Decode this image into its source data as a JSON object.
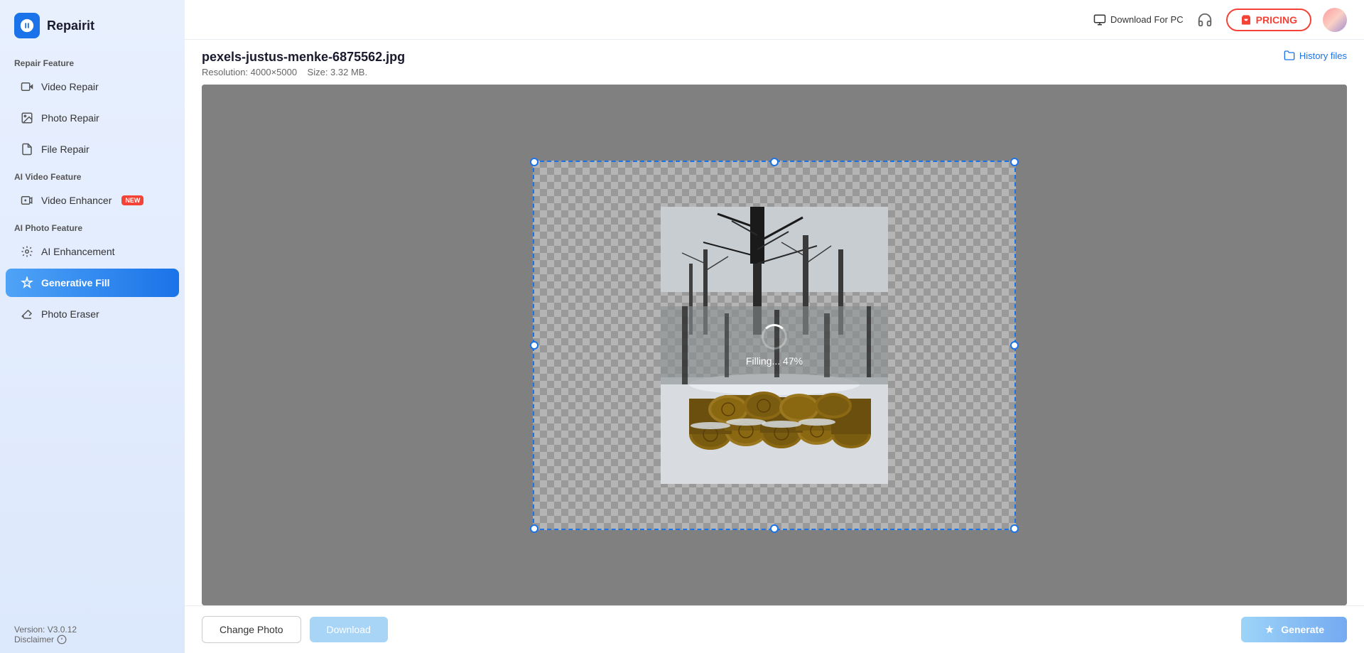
{
  "app": {
    "name": "Repairit"
  },
  "topbar": {
    "download_pc_label": "Download For PC",
    "pricing_label": "PRICING",
    "history_files_label": "History files"
  },
  "sidebar": {
    "repair_feature_label": "Repair Feature",
    "ai_video_feature_label": "AI Video Feature",
    "ai_photo_feature_label": "AI Photo Feature",
    "items": [
      {
        "id": "video-repair",
        "label": "Video Repair",
        "icon": "video"
      },
      {
        "id": "photo-repair",
        "label": "Photo Repair",
        "icon": "photo"
      },
      {
        "id": "file-repair",
        "label": "File Repair",
        "icon": "file"
      },
      {
        "id": "video-enhancer",
        "label": "Video Enhancer",
        "icon": "enhance",
        "badge": "NEW"
      },
      {
        "id": "ai-enhancement",
        "label": "AI Enhancement",
        "icon": "ai"
      },
      {
        "id": "generative-fill",
        "label": "Generative Fill",
        "icon": "gen",
        "active": true
      },
      {
        "id": "photo-eraser",
        "label": "Photo Eraser",
        "icon": "eraser"
      }
    ],
    "version": "Version: V3.0.12",
    "disclaimer": "Disclaimer"
  },
  "file": {
    "name": "pexels-justus-menke-6875562.jpg",
    "resolution": "Resolution: 4000×5000",
    "size": "Size: 3.32 MB."
  },
  "canvas": {
    "loading_text": "Filling... 47%",
    "progress": 47
  },
  "actions": {
    "change_photo": "Change Photo",
    "download": "Download",
    "generate": "Generate"
  }
}
